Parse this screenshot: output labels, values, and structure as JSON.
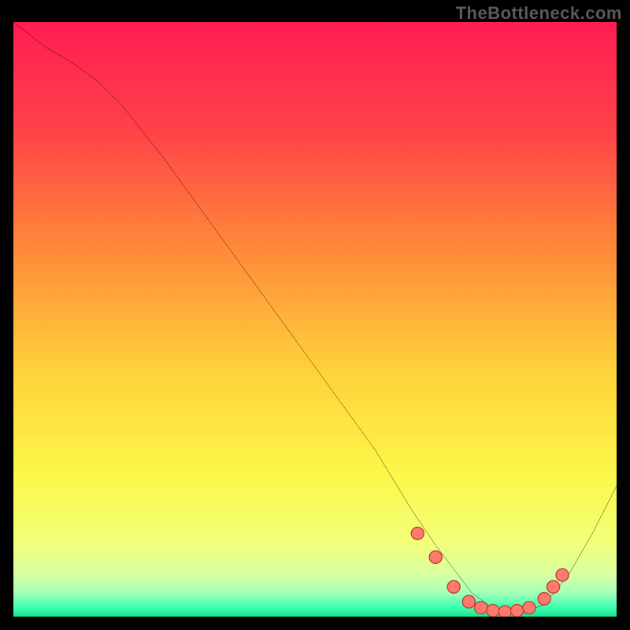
{
  "watermark": "TheBottleneck.com",
  "chart_data": {
    "type": "line",
    "title": "",
    "xlabel": "",
    "ylabel": "",
    "xlim": [
      0,
      100
    ],
    "ylim": [
      0,
      100
    ],
    "grid": false,
    "legend": false,
    "series": [
      {
        "name": "bottleneck-curve",
        "x": [
          0,
          5,
          10,
          14,
          18,
          25,
          35,
          45,
          55,
          60,
          63,
          66,
          70,
          73,
          76,
          80,
          82,
          84,
          88,
          92,
          96,
          100
        ],
        "y": [
          100,
          96,
          93,
          90,
          86,
          77,
          63,
          49,
          35,
          28,
          23,
          18,
          12,
          8,
          4,
          1,
          0.5,
          0.5,
          2,
          7,
          14,
          22
        ]
      }
    ],
    "markers": [
      {
        "x": 67.0,
        "y": 14.0
      },
      {
        "x": 70.0,
        "y": 10.0
      },
      {
        "x": 73.0,
        "y": 5.0
      },
      {
        "x": 75.5,
        "y": 2.5
      },
      {
        "x": 77.5,
        "y": 1.5
      },
      {
        "x": 79.5,
        "y": 1.0
      },
      {
        "x": 81.5,
        "y": 0.8
      },
      {
        "x": 83.5,
        "y": 1.0
      },
      {
        "x": 85.5,
        "y": 1.5
      },
      {
        "x": 88.0,
        "y": 3.0
      },
      {
        "x": 89.5,
        "y": 5.0
      },
      {
        "x": 91.0,
        "y": 7.0
      }
    ],
    "gradient_stops": [
      {
        "pct": 0.0,
        "color": "#ff1d52"
      },
      {
        "pct": 0.18,
        "color": "#ff4248"
      },
      {
        "pct": 0.38,
        "color": "#ff8b39"
      },
      {
        "pct": 0.58,
        "color": "#ffd23a"
      },
      {
        "pct": 0.75,
        "color": "#fcf749"
      },
      {
        "pct": 0.86,
        "color": "#f2ff77"
      },
      {
        "pct": 0.915,
        "color": "#d8ffa0"
      },
      {
        "pct": 0.945,
        "color": "#a8ffb8"
      },
      {
        "pct": 0.97,
        "color": "#3fffb0"
      },
      {
        "pct": 0.985,
        "color": "#17e896"
      },
      {
        "pct": 1.0,
        "color": "#0fc77f"
      }
    ],
    "marker_color": "#ff7a6e",
    "marker_stroke": "#c04030",
    "curve_color": "#000000",
    "curve_width": 3
  }
}
